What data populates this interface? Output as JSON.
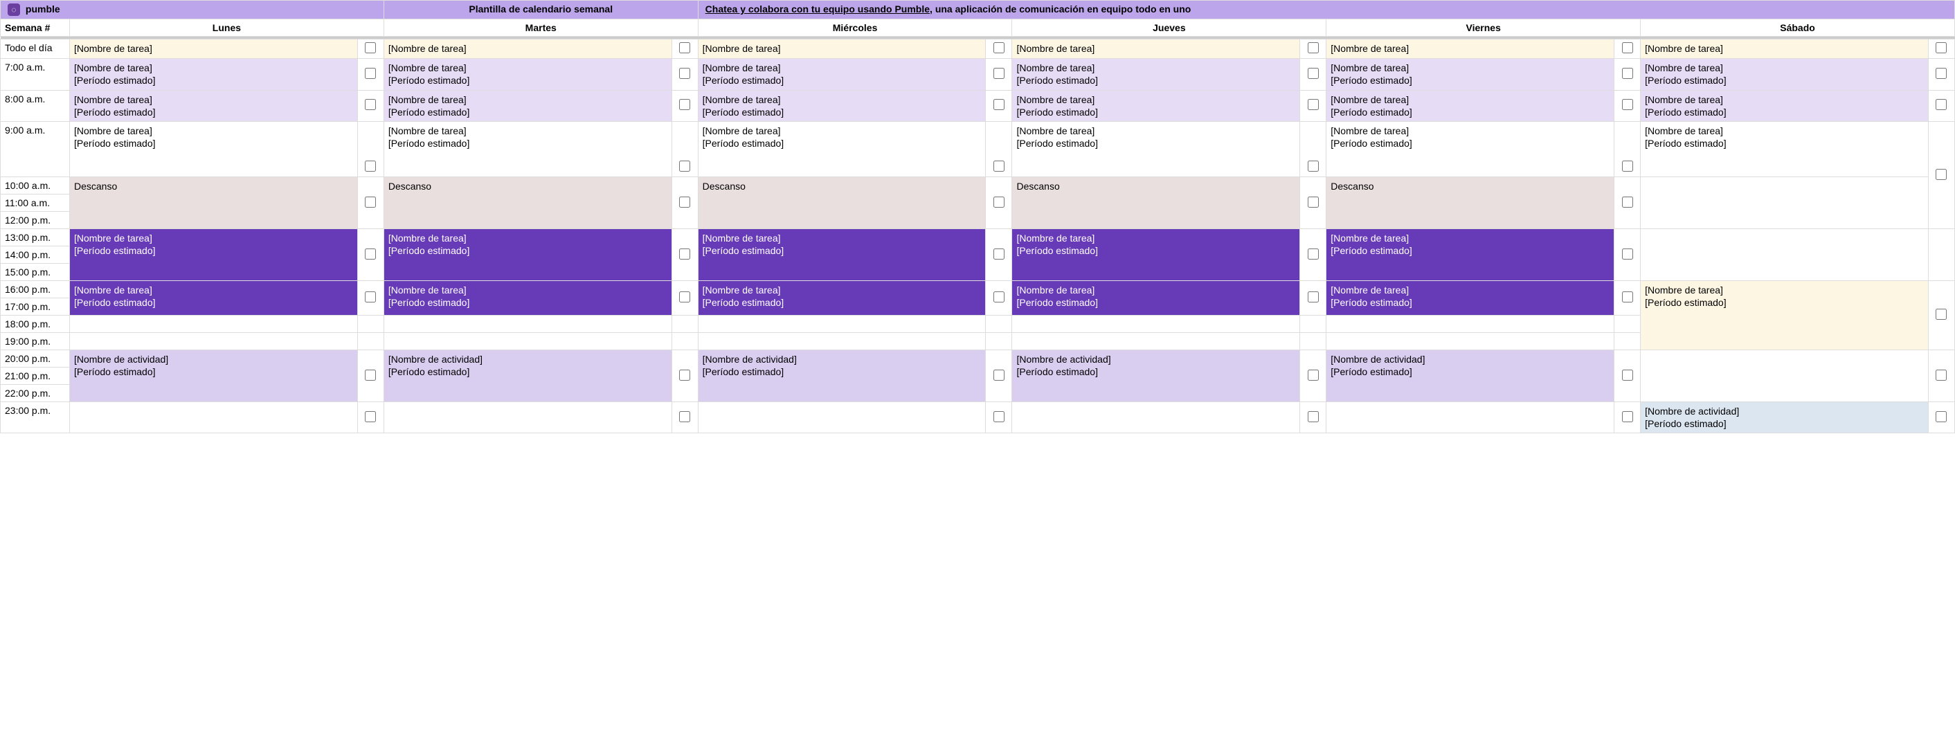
{
  "banner": {
    "logo_text": "pumble",
    "title": "Plantilla de calendario semanal",
    "promo_bold": "Chatea y colabora con tu equipo usando Pumble,",
    "promo_rest": " una aplicación de comunicación en equipo todo en uno"
  },
  "headers": {
    "week": "Semana #",
    "days": [
      "Lunes",
      "Martes",
      "Miércoles",
      "Jueves",
      "Viernes",
      "Sábado"
    ]
  },
  "times": [
    "Todo el día",
    "7:00 a.m.",
    "8:00 a.m.",
    "9:00 a.m.",
    "10:00 a.m.",
    "11:00 a.m.",
    "12:00 p.m.",
    "13:00 p.m.",
    "14:00 p.m.",
    "15:00 p.m.",
    "16:00 p.m.",
    "17:00 p.m.",
    "18:00 p.m.",
    "19:00 p.m.",
    "20:00 p.m.",
    "21:00 p.m.",
    "22:00 p.m.",
    "23:00 p.m."
  ],
  "labels": {
    "task_name": "[Nombre de tarea]",
    "period": "[Período estimado]",
    "break": "Descanso",
    "activity": "[Nombre de actividad]"
  }
}
